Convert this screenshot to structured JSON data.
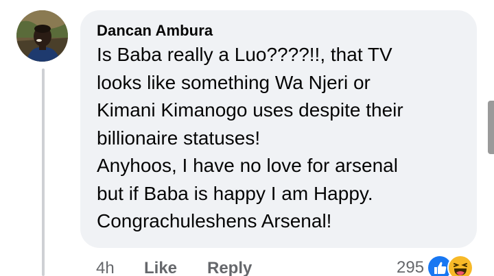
{
  "comment": {
    "author": "Dancan Ambura",
    "lines": [
      "Is Baba really a Luo????!!, that TV",
      "looks like something Wa Njeri or",
      "Kimani Kimanogo uses despite their",
      "billionaire statuses!",
      "Anyhoos, I have no love for arsenal",
      "but if Baba is happy I am Happy.",
      "Congrachuleshens Arsenal!"
    ],
    "timestamp": "4h",
    "like_label": "Like",
    "reply_label": "Reply",
    "reaction_count": "295",
    "reactions": [
      "like-icon",
      "haha-icon"
    ]
  },
  "colors": {
    "bubble": "#f0f2f5",
    "meta_text": "#65676b",
    "like_blue": "#1877f2",
    "haha_yellow": "#f7b928"
  }
}
